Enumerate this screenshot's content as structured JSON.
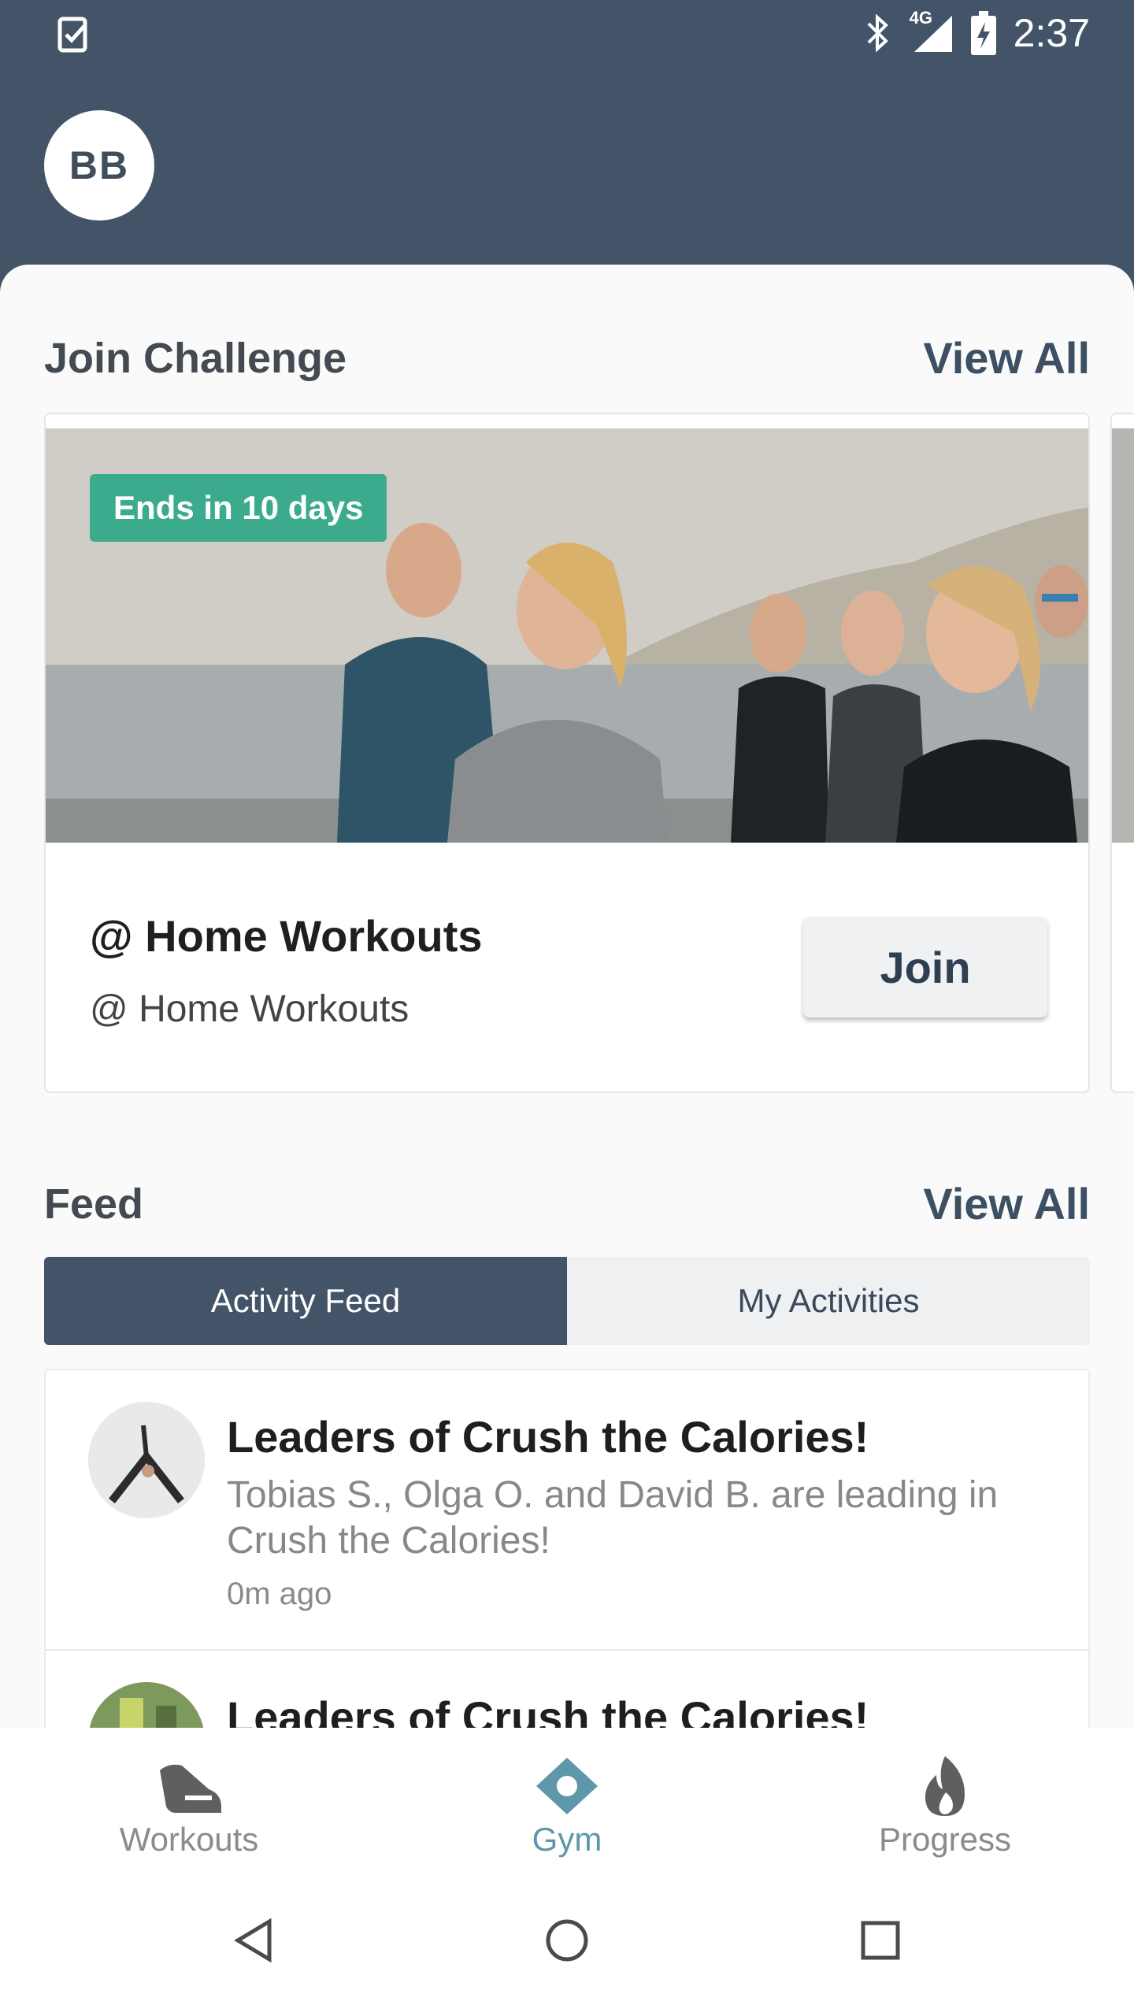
{
  "status_bar": {
    "network": "4G",
    "time": "2:37"
  },
  "header": {
    "avatar_initials": "BB"
  },
  "challenges": {
    "title": "Join Challenge",
    "view_all": "View All",
    "card": {
      "badge": "Ends in 10 days",
      "name": "@ Home Workouts",
      "subtitle": "@ Home Workouts",
      "join_label": "Join"
    }
  },
  "feed": {
    "title": "Feed",
    "view_all": "View All",
    "tabs": [
      {
        "label": "Activity Feed",
        "active": true
      },
      {
        "label": "My Activities",
        "active": false
      }
    ],
    "items": [
      {
        "title": "Leaders of Crush the Calories!",
        "description": "Tobias S., Olga O. and David B. are leading in Crush the Calories!",
        "time": "0m ago"
      },
      {
        "title": "Leaders of Crush the Calories!",
        "description": "",
        "time": ""
      }
    ]
  },
  "bottom_nav": {
    "items": [
      {
        "label": "Workouts",
        "icon": "shoe-icon",
        "active": false
      },
      {
        "label": "Gym",
        "icon": "gym-diamond-icon",
        "active": true
      },
      {
        "label": "Progress",
        "icon": "flame-icon",
        "active": false
      }
    ]
  },
  "colors": {
    "header_bg": "#435468",
    "badge_green": "#3cab8d",
    "active_nav": "#5f97aa"
  }
}
